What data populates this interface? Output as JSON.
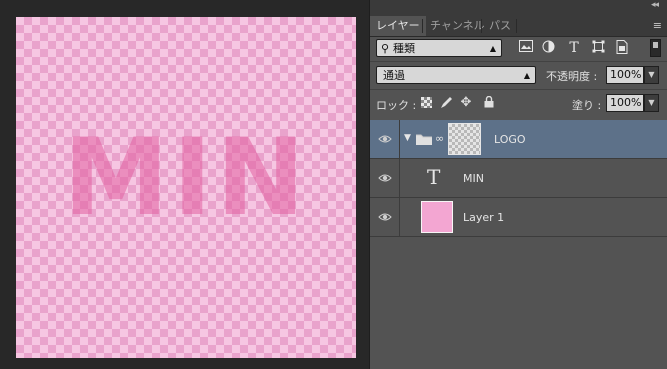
{
  "canvas": {
    "document_text": "MIN"
  },
  "panel": {
    "tabs": [
      {
        "label": "レイヤー",
        "active": true
      },
      {
        "label": "チャンネル",
        "active": false
      },
      {
        "label": "パス",
        "active": false
      }
    ],
    "filter": {
      "kind_label": "種類",
      "icons": [
        "image-filter-icon",
        "adjustment-filter-icon",
        "type-filter-icon",
        "shape-filter-icon",
        "smart-object-filter-icon"
      ]
    },
    "blend_mode": "通過",
    "opacity_label": "不透明度 :",
    "opacity_value": "100%",
    "lock_label": "ロック :",
    "fill_label": "塗り :",
    "fill_value": "100%"
  },
  "layers": [
    {
      "name": "LOGO",
      "type": "group",
      "selected": true,
      "visible": true
    },
    {
      "name": "MIN",
      "type": "text",
      "selected": false,
      "visible": true
    },
    {
      "name": "Layer 1",
      "type": "pixel",
      "selected": false,
      "visible": true,
      "thumb_color": "#f3a6d2"
    }
  ],
  "colors": {
    "selection": "#5d7189",
    "panel_bg": "#535353",
    "checker_pink": "#f6c6e2"
  }
}
